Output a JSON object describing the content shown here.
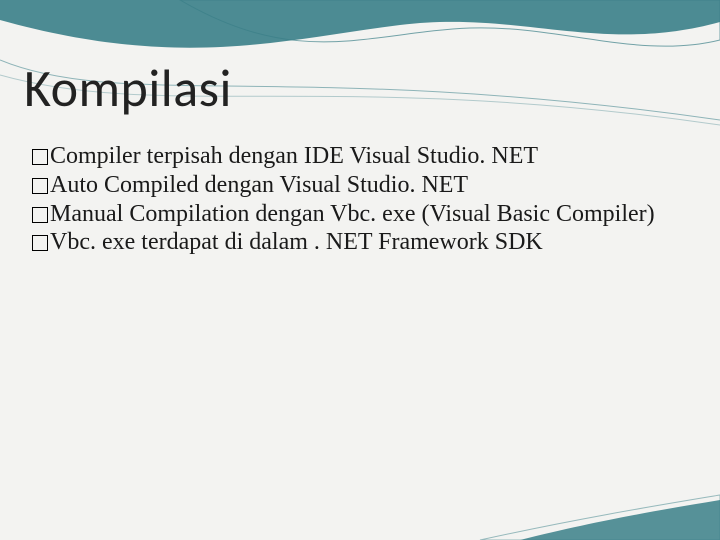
{
  "title": "Kompilasi",
  "bullets": [
    "Compiler  terpisah dengan IDE Visual Studio. NET",
    "Auto Compiled dengan Visual Studio. NET",
    "Manual Compilation dengan Vbc. exe  (Visual Basic Compiler)",
    "Vbc. exe terdapat di dalam . NET Framework SDK"
  ]
}
